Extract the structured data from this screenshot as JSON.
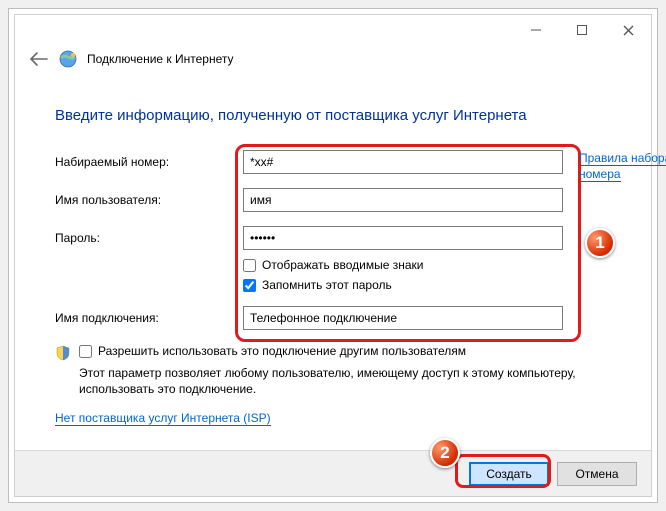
{
  "titlebar": {
    "title": "Подключение к Интернету"
  },
  "headline": "Введите информацию, полученную от поставщика услуг Интернета",
  "fields": {
    "dial_number": {
      "label": "Набираемый номер:",
      "value": "*xx#"
    },
    "username": {
      "label": "Имя пользователя:",
      "value": "имя"
    },
    "password": {
      "label": "Пароль:",
      "value": "••••••"
    },
    "connection": {
      "label": "Имя подключения:",
      "value": "Телефонное подключение"
    }
  },
  "checkboxes": {
    "show_chars": {
      "label": "Отображать вводимые знаки",
      "checked": false
    },
    "remember": {
      "label": "Запомнить этот пароль",
      "checked": true
    },
    "allow_others": {
      "label": "Разрешить использовать это подключение другим пользователям",
      "checked": false
    }
  },
  "links": {
    "dial_rules": "Правила набора номера",
    "no_isp": "Нет поставщика услуг Интернета (ISP)"
  },
  "allow_desc": "Этот параметр позволяет любому пользователю, имеющему доступ к этому компьютеру, использовать это подключение.",
  "buttons": {
    "create": "Создать",
    "cancel": "Отмена"
  },
  "badges": {
    "one": "1",
    "two": "2"
  }
}
